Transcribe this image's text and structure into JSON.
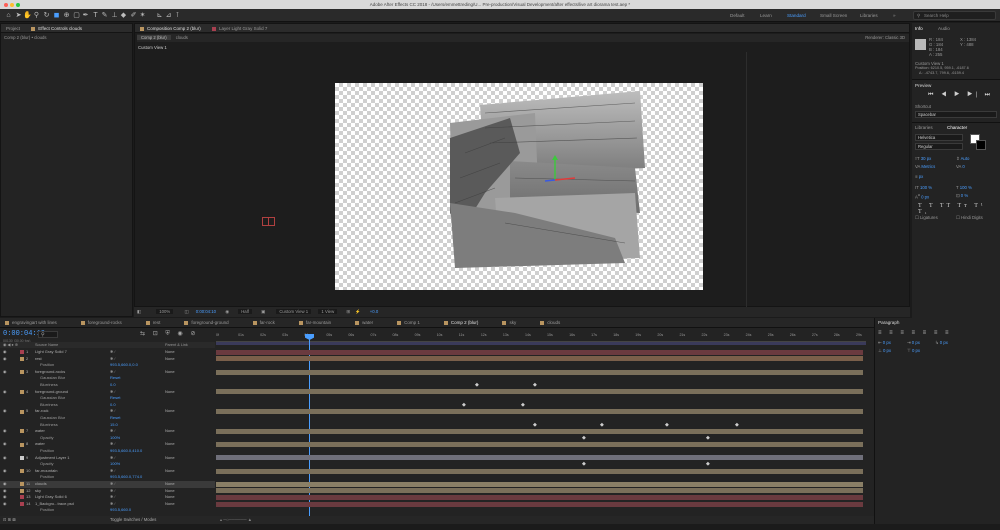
{
  "window": {
    "title": "Adobe After Effects CC 2018 - /Users/emmettreding/U... Pre-production/Visual Development/after effects/live art diorama test.aep *"
  },
  "toolbar": {
    "workspaces": [
      "Default",
      "Learn",
      "Standard",
      "Small Screen",
      "Libraries"
    ],
    "active_workspace": "Standard",
    "search_placeholder": "Search Help"
  },
  "project_panel": {
    "tabs": [
      "Project",
      "Effect Controls clouds"
    ],
    "subtitle": "Comp 2 (blur) • clouds"
  },
  "composition_panel": {
    "tabs": [
      "Composition Comp 2 (blur)",
      "Layer Light Gray Solid 7"
    ],
    "breadcrumbs": [
      "Comp 2 (blur)",
      "clouds"
    ],
    "renderer": "Renderer: Classic 3D",
    "view_label": "Custom View 1"
  },
  "viewer_controls": {
    "zoom": "100%",
    "timecode": "0:00:04:10",
    "resolution": "Half",
    "view": "Custom View 1",
    "views": "1 View",
    "offset": "+0.0"
  },
  "comp_tabs": [
    "engravingart with lines",
    "foreground-rocks",
    "rest",
    "foreground-ground",
    "far-rock",
    "far-mountain",
    "water",
    "Comp 1",
    "Comp 2 (blur)",
    "sky",
    "clouds"
  ],
  "active_comp_tab": "Comp 2 (blur)",
  "timeline": {
    "timecode": "0:00:04:10",
    "fps_note": "00130 (30.00 fps)",
    "headers": {
      "source": "Source Name",
      "parent": "Parent & Link"
    },
    "ruler": [
      "0f",
      "01s",
      "02s",
      "03s",
      "04s",
      "05s",
      "06s",
      "07s",
      "08s",
      "09s",
      "10s",
      "11s",
      "12s",
      "13s",
      "14s",
      "15s",
      "16s",
      "17s",
      "18s",
      "19s",
      "20s",
      "21s",
      "22s",
      "23s",
      "24s",
      "25s",
      "26s",
      "27s",
      "28s",
      "29s"
    ],
    "toggle_label": "Toggle Switches / Modes",
    "rows": [
      {
        "num": "1",
        "name": "Light Gray Solid 7",
        "parent": "None",
        "color": "#a84050",
        "bar": "#6a3a3f"
      },
      {
        "num": "2",
        "name": "rest",
        "parent": "None",
        "color": "#b99560",
        "bar": "#7a5f4a"
      },
      {
        "num": "",
        "name": "Position",
        "value": "993.5,660.0,0.0",
        "prop": true
      },
      {
        "num": "3",
        "name": "foreground-rocks",
        "parent": "None",
        "color": "#b99560",
        "bar": "#7a6f5a"
      },
      {
        "num": "",
        "name": "Gaussian Blur",
        "value": "Reset",
        "prop": true
      },
      {
        "num": "",
        "name": "Blurriness",
        "value": "0.0",
        "prop": true
      },
      {
        "num": "4",
        "name": "foreground-ground",
        "parent": "None",
        "color": "#b99560",
        "bar": "#7a6f5a"
      },
      {
        "num": "",
        "name": "Gaussian Blur",
        "value": "Reset",
        "prop": true
      },
      {
        "num": "",
        "name": "Blurriness",
        "value": "0.0",
        "prop": true
      },
      {
        "num": "5",
        "name": "far-rock",
        "parent": "None",
        "color": "#b99560",
        "bar": "#7a6f5a"
      },
      {
        "num": "",
        "name": "Gaussian Blur",
        "value": "Reset",
        "prop": true
      },
      {
        "num": "",
        "name": "Blurriness",
        "value": "15.0",
        "prop": true
      },
      {
        "num": "7",
        "name": "water",
        "parent": "None",
        "color": "#b99560",
        "bar": "#7a6f5a"
      },
      {
        "num": "",
        "name": "Opacity",
        "value": "100%",
        "prop": true
      },
      {
        "num": "8",
        "name": "water",
        "parent": "None",
        "color": "#b99560",
        "bar": "#7a6f5a"
      },
      {
        "num": "",
        "name": "Position",
        "value": "993.5,660.0,410.0",
        "prop": true
      },
      {
        "num": "9",
        "name": "Adjustment Layer 1",
        "parent": "None",
        "color": "#cccccc",
        "bar": "#6f6f7a"
      },
      {
        "num": "",
        "name": "Opacity",
        "value": "100%",
        "prop": true
      },
      {
        "num": "10",
        "name": "far-mountain",
        "parent": "None",
        "color": "#b99560",
        "bar": "#7a6f5a"
      },
      {
        "num": "",
        "name": "Position",
        "value": "993.5,660.0,774.0",
        "prop": true
      },
      {
        "num": "11",
        "name": "clouds",
        "parent": "None",
        "color": "#b99560",
        "bar": "#8a7f66",
        "selected": true
      },
      {
        "num": "12",
        "name": "sky",
        "parent": "None",
        "color": "#b99560",
        "bar": "#7a6f5a"
      },
      {
        "num": "13",
        "name": "Light Gray Solid 6",
        "parent": "None",
        "color": "#a84050",
        "bar": "#6a3a3f"
      },
      {
        "num": "14",
        "name": "1_Backgro...trace.psd",
        "parent": "None",
        "color": "#a84050",
        "bar": "#6a3a3f"
      },
      {
        "num": "",
        "name": "Position",
        "value": "993.5,660.0",
        "prop": true
      }
    ]
  },
  "info_panel": {
    "tabs": [
      "Info",
      "Audio"
    ],
    "r": "R : 184",
    "g": "G : 184",
    "b": "B : 184",
    "a": "A : 255",
    "x": "X : 1384",
    "y": "Y : 488",
    "view": "Custom View 1",
    "position": "Position: 6210.5, 959.1, -6187.6",
    "delta": "Δ : -4743.7, 799.6, -6159.4"
  },
  "preview_panel": {
    "title": "Preview",
    "shortcut_label": "Shortcut",
    "shortcut_value": "Spacebar"
  },
  "character_panel": {
    "tabs": [
      "Libraries",
      "Character"
    ],
    "font": "Helvetica",
    "style": "Regular",
    "size": "30 px",
    "leading": "Auto",
    "kerning": "Metrics",
    "tracking": "0",
    "stroke": "px",
    "vscale": "100 %",
    "hscale": "100 %",
    "baseline": "0 px",
    "tsume": "0 %",
    "ligatures": "Ligatures",
    "hindi": "Hindi Digits"
  },
  "paragraph_panel": {
    "title": "Paragraph",
    "indent1": "0 px",
    "indent2": "0 px",
    "indent3": "0 px",
    "space1": "0 px",
    "space2": "0 px"
  }
}
